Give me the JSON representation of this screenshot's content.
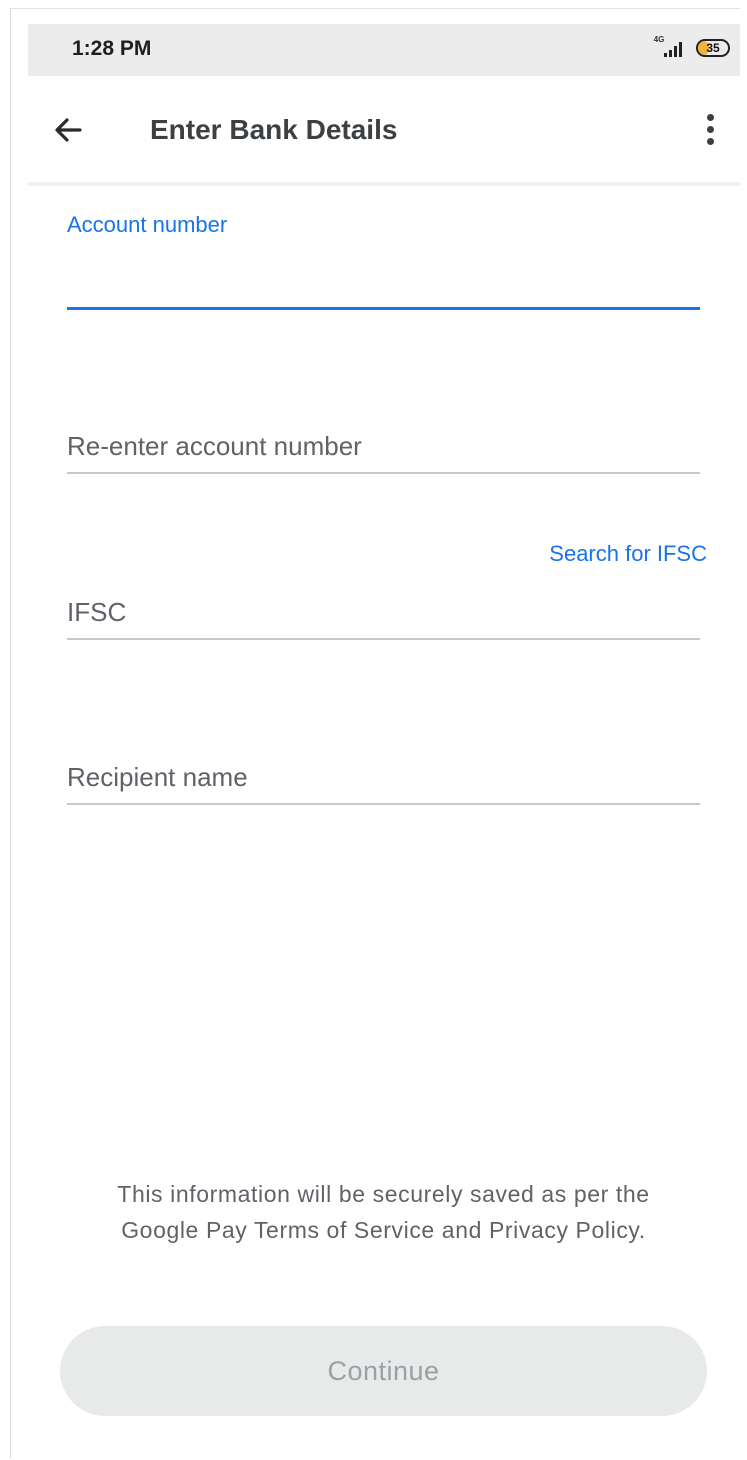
{
  "status_bar": {
    "time": "1:28 PM",
    "network_label": "4G",
    "battery_level": "35"
  },
  "app_bar": {
    "title": "Enter Bank Details",
    "back_icon": "arrow-back-icon",
    "more_icon": "more-vert-icon"
  },
  "form": {
    "account_number": {
      "label": "Account number",
      "value": "",
      "focused": true
    },
    "reenter_account_number": {
      "placeholder": "Re-enter account number",
      "value": ""
    },
    "ifsc": {
      "placeholder": "IFSC",
      "value": "",
      "search_link": "Search for IFSC"
    },
    "recipient_name": {
      "placeholder": "Recipient name",
      "value": ""
    }
  },
  "disclaimer": "This information will be securely saved as per the Google Pay Terms of Service and Privacy Policy.",
  "continue_button": {
    "label": "Continue",
    "enabled": false
  },
  "colors": {
    "accent": "#1a73e8",
    "status_bar_bg": "#ececec",
    "button_disabled_bg": "#e8eaea",
    "button_disabled_text": "#9aa0a6",
    "battery_fill": "#f2b43b"
  }
}
